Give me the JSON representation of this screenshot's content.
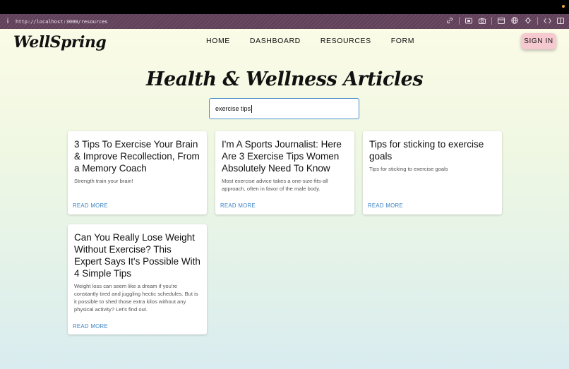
{
  "browser": {
    "url": "http://localhost:3000/resources",
    "info_icon": "info-icon",
    "tool_icons": [
      "link-icon",
      "screenshot-icon",
      "camera-icon",
      "window-icon",
      "globe-icon",
      "extension-icon",
      "code-icon",
      "sidebar-icon"
    ]
  },
  "header": {
    "logo": "WellSpring",
    "nav": [
      "HOME",
      "DASHBOARD",
      "RESOURCES",
      "FORM"
    ],
    "signin_label": "SIGN IN"
  },
  "main": {
    "title": "Health & Wellness Articles",
    "search_value": "exercise tips",
    "cards": [
      {
        "title": "3 Tips To Exercise Your Brain & Improve Recollection, From a Memory Coach",
        "desc": "Strength train your brain!",
        "link": "READ MORE"
      },
      {
        "title": "I'm A Sports Journalist: Here Are 3 Exercise Tips Women Absolutely Need To Know",
        "desc": "Most exercise advice takes a one-size-fits-all approach, often in favor of the male body.",
        "link": "READ MORE"
      },
      {
        "title": "Tips for sticking to exercise goals",
        "desc": "Tips for sticking to exercise goals",
        "link": "READ MORE"
      },
      {
        "title": "Can You Really Lose Weight Without Exercise? This Expert Says It's Possible With 4 Simple Tips",
        "desc": "Weight loss can seem like a dream if you're constantly tired and juggling hectic schedules. But is it possible to shed those extra kilos without any physical activity? Let's find out.",
        "link": "READ MORE"
      }
    ]
  },
  "colors": {
    "accent": "#3b82c4",
    "signin_bg": "#f5c9cf",
    "search_border": "#4a8fc9"
  }
}
